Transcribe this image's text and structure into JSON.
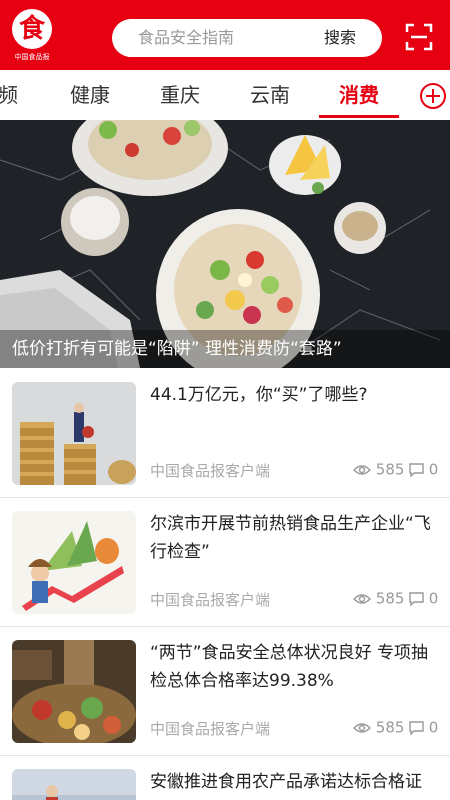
{
  "header": {
    "logo_glyph": "食",
    "logo_text": "中国食品报",
    "search_placeholder": "食品安全指南",
    "search_button": "搜索",
    "brand_color": "#e60012"
  },
  "tabs": [
    {
      "label": "频"
    },
    {
      "label": "健康"
    },
    {
      "label": "重庆"
    },
    {
      "label": "云南"
    },
    {
      "label": "消费",
      "active": true
    }
  ],
  "banner": {
    "title": "低价打折有可能是“陷阱” 理性消费防“套路”"
  },
  "news": [
    {
      "title": "44.1万亿元，你“买”了哪些?",
      "source": "中国食品报客户端",
      "views": "585",
      "comments": "0"
    },
    {
      "title": "尔滨市开展节前热销食品生产企业“飞行检查”",
      "source": "中国食品报客户端",
      "views": "585",
      "comments": "0"
    },
    {
      "title": "“两节”食品安全总体状况良好 专项抽检总体合格率达99.38%",
      "source": "中国食品报客户端",
      "views": "585",
      "comments": "0"
    },
    {
      "title": "安徽推进食用农产品承诺达标合格证"
    }
  ]
}
